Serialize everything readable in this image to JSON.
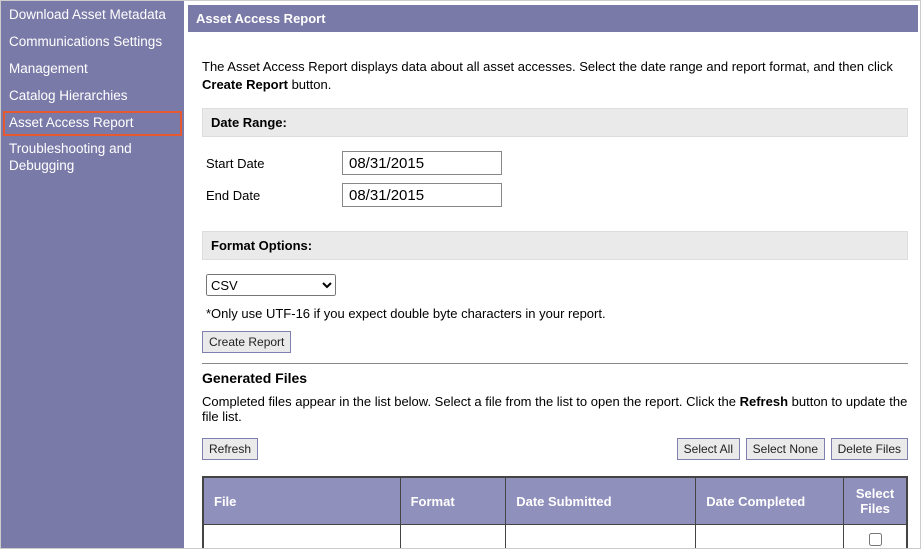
{
  "sidebar": {
    "items": [
      {
        "label": "Download Asset Metadata",
        "selected": false
      },
      {
        "label": "Communications Settings",
        "selected": false
      },
      {
        "label": "Management",
        "selected": false
      },
      {
        "label": "Catalog Hierarchies",
        "selected": false
      },
      {
        "label": "Asset Access Report",
        "selected": true
      },
      {
        "label": "Troubleshooting and Debugging",
        "selected": false
      }
    ]
  },
  "header": {
    "tab_title": "Asset Access Report"
  },
  "intro": {
    "prefix": "The Asset Access Report displays data about all asset accesses. Select the date range and report format, and then click ",
    "bold": "Create Report",
    "suffix": " button."
  },
  "date_range": {
    "heading": "Date Range:",
    "start_label": "Start Date",
    "start_value": "08/31/2015",
    "end_label": "End Date",
    "end_value": "08/31/2015"
  },
  "format": {
    "heading": "Format Options:",
    "selected": "CSV",
    "options": [
      "CSV"
    ],
    "hint": "*Only use UTF-16 if you expect double byte characters in your report."
  },
  "buttons": {
    "create_report": "Create Report",
    "refresh": "Refresh",
    "select_all": "Select All",
    "select_none": "Select None",
    "delete_files": "Delete Files"
  },
  "generated": {
    "title": "Generated Files",
    "desc_prefix": "Completed files appear in the list below. Select a file from the list to open the report. Click the ",
    "desc_bold": "Refresh",
    "desc_suffix": " button to update the file list."
  },
  "table": {
    "columns": {
      "file": "File",
      "format": "Format",
      "date_submitted": "Date Submitted",
      "date_completed": "Date Completed",
      "select_files": "Select Files"
    },
    "rows": [
      {
        "file": "",
        "format": "",
        "date_submitted": "",
        "date_completed": "",
        "selected": false
      }
    ]
  }
}
